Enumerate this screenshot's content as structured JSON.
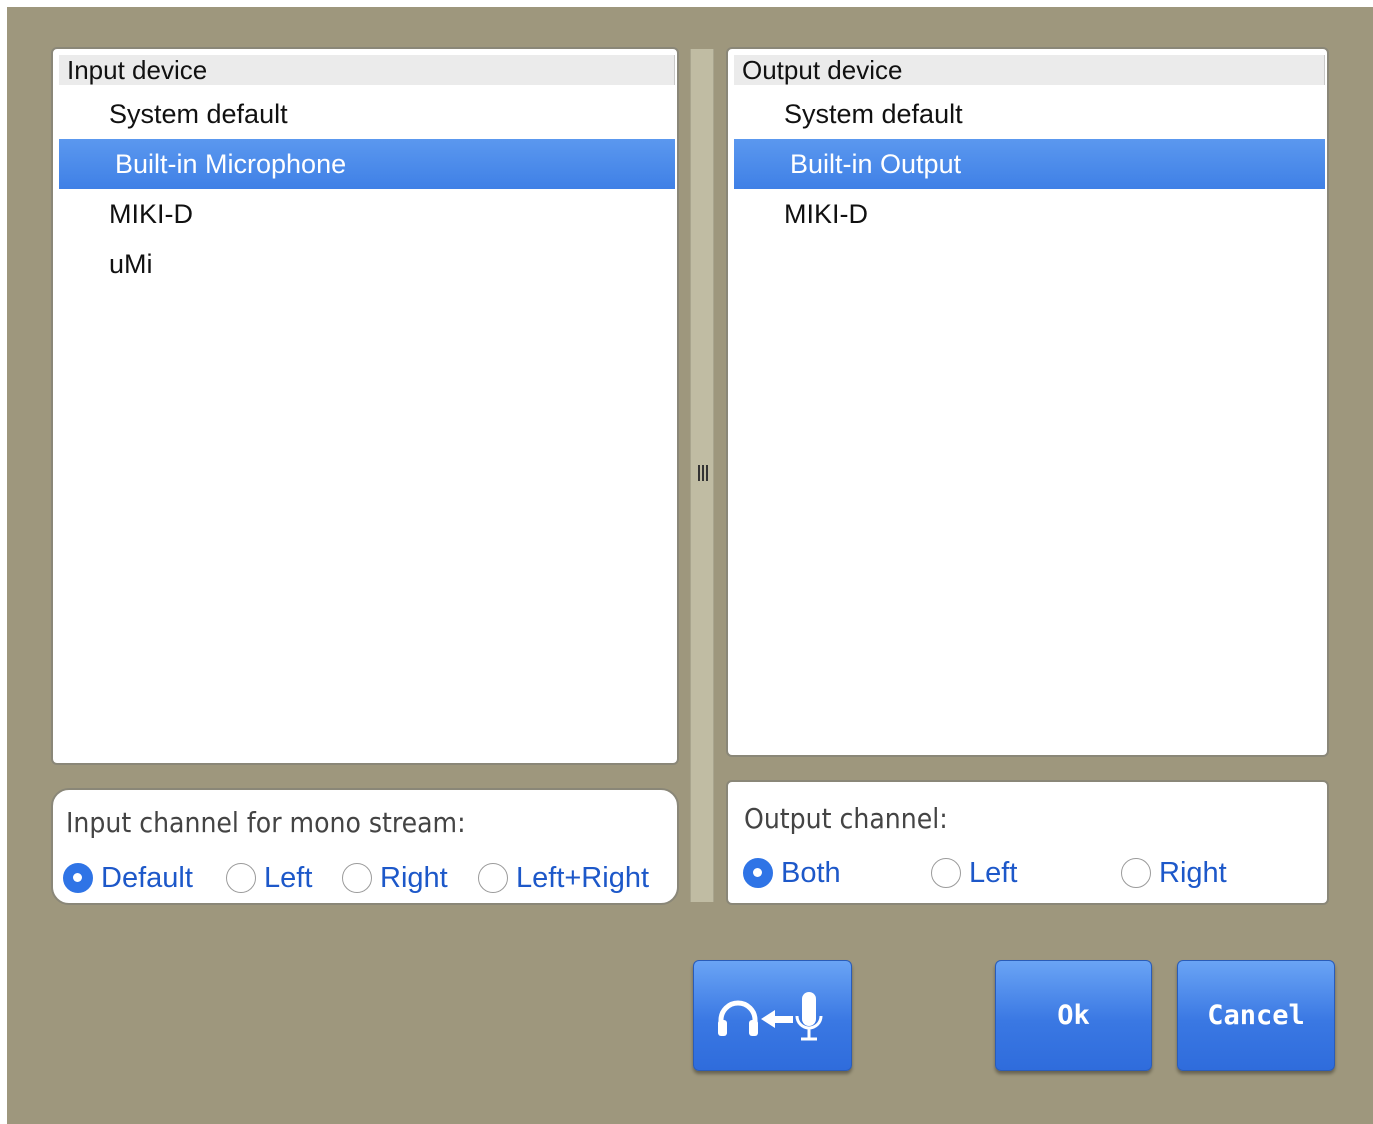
{
  "input": {
    "header": "Input device",
    "devices": [
      "System default",
      "Built-in Microphone",
      "MIKI-D",
      "uMi"
    ],
    "selected_index": 1,
    "channel_label": "Input channel for mono stream:",
    "channels": [
      "Default",
      "Left",
      "Right",
      "Left+Right"
    ],
    "selected_channel": "Default"
  },
  "output": {
    "header": "Output device",
    "devices": [
      "System default",
      "Built-in Output",
      "MIKI-D"
    ],
    "selected_index": 1,
    "channel_label": "Output channel:",
    "channels": [
      "Both",
      "Left",
      "Right"
    ],
    "selected_channel": "Both"
  },
  "buttons": {
    "monitor_icons": [
      "headphones-icon",
      "arrow-left-icon",
      "microphone-icon"
    ],
    "ok_label": "Ok",
    "cancel_label": "Cancel"
  },
  "colors": {
    "background": "#9e977d",
    "selection": "#4a8bec",
    "radio_text": "#1d58c9",
    "button": "#3a78e3"
  }
}
